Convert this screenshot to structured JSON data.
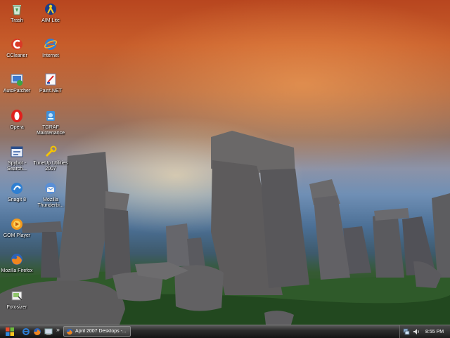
{
  "desktop_icons": [
    {
      "label": "Trash",
      "icon": "recycle-bin-icon"
    },
    {
      "label": "AIM Lite",
      "icon": "aim-icon"
    },
    {
      "label": "CCleaner",
      "icon": "ccleaner-icon"
    },
    {
      "label": "Internet",
      "icon": "internet-explorer-icon"
    },
    {
      "label": "AutoPatcher",
      "icon": "autopatcher-icon"
    },
    {
      "label": "Paint.NET",
      "icon": "paint-net-icon"
    },
    {
      "label": "Opera",
      "icon": "opera-icon"
    },
    {
      "label": "TGRAF Maintenance",
      "icon": "tgraf-icon"
    },
    {
      "label": "Spybot - Search...",
      "icon": "spybot-icon"
    },
    {
      "label": "TuneUp Utilities 2007",
      "icon": "tuneup-icon"
    },
    {
      "label": "SnagIt 8",
      "icon": "snagit-icon"
    },
    {
      "label": "Mozilla Thunderbi...",
      "icon": "thunderbird-icon"
    },
    {
      "label": "GOM Player",
      "icon": "gom-player-icon"
    },
    {
      "label": "Mozilla Firefox",
      "icon": "firefox-icon"
    },
    {
      "label": "Fotosizer",
      "icon": "fotosizer-icon"
    }
  ],
  "taskbar": {
    "chevron": "»",
    "task_button_label": "April 2007 Desktops -...",
    "clock": "8:55 PM"
  }
}
